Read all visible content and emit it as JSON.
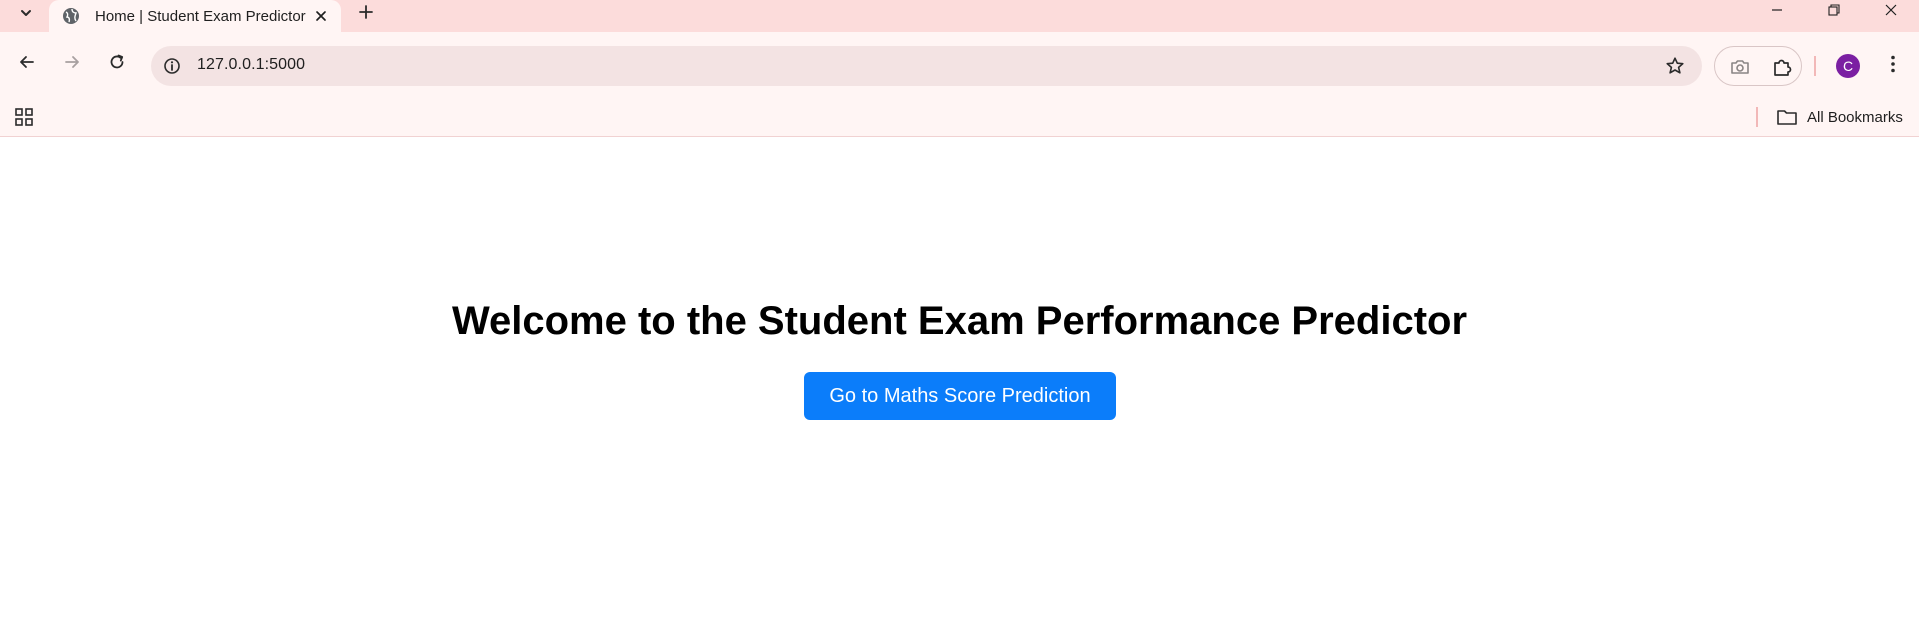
{
  "browser": {
    "tab": {
      "title": "Home | Student Exam Predictor",
      "favicon": "globe-icon"
    },
    "address_bar": {
      "url": "127.0.0.1:5000"
    },
    "profile": {
      "initial": "C",
      "color": "#7b1fa2"
    },
    "bookmarks_bar": {
      "all_bookmarks_label": "All Bookmarks"
    },
    "theme": {
      "tabstrip_bg": "#fcdcdb",
      "toolbar_bg": "#fff5f4",
      "omnibox_bg": "#f3e3e3"
    }
  },
  "page": {
    "heading": "Welcome to the Student Exam Performance Predictor",
    "cta_label": "Go to Maths Score Prediction",
    "cta_color": "#0b7dfa"
  }
}
